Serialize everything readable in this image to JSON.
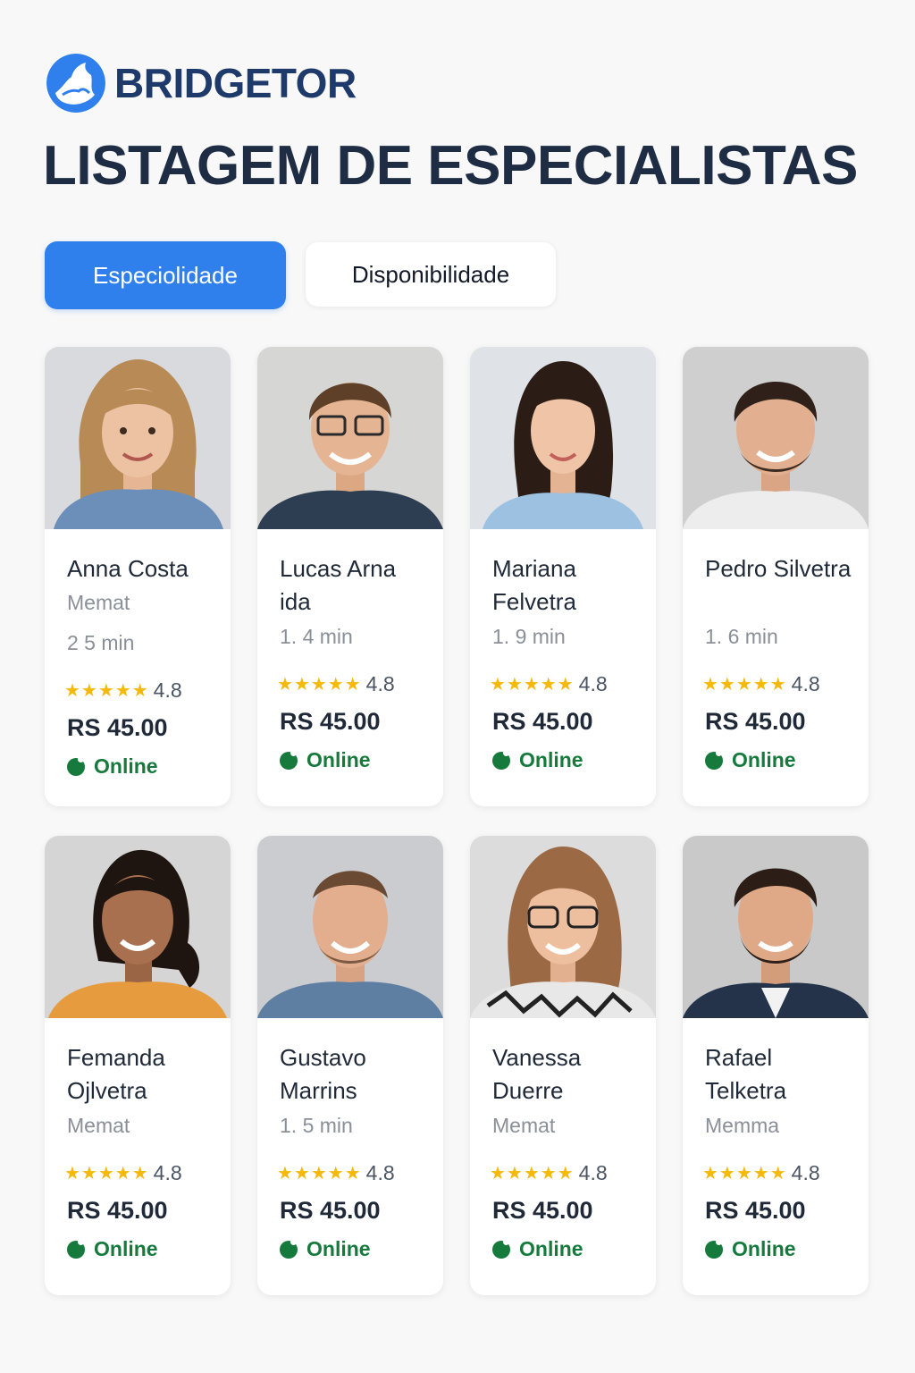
{
  "brand": {
    "name": "BRIDGETOR"
  },
  "page": {
    "title": "LISTAGEM DE ESPECIALISTAS"
  },
  "tabs": [
    {
      "label": "Especiolidade",
      "active": true
    },
    {
      "label": "Disponibilidade",
      "active": false
    }
  ],
  "specialists": [
    {
      "name": "Anna Costa",
      "meta": "Memat",
      "stars": "★★★★★",
      "rating": "4.8",
      "price": "RS 45.00",
      "status": "Online"
    },
    {
      "name": "Lucas Arna ida",
      "meta": "1. 4 min",
      "stars": "★★★★★",
      "rating": "4.8",
      "price": "RS 45.00",
      "status": "Online"
    },
    {
      "name": "Mariana Felvetra",
      "meta": "1. 9 min",
      "stars": "★★★★★",
      "rating": "4.8",
      "price": "RS 45.00",
      "status": "Online"
    },
    {
      "name": "Pedro Silvetra",
      "meta": "1. 6 min",
      "stars": "★★★★★",
      "rating": "4.8",
      "price": "RS 45.00",
      "status": "Online"
    },
    {
      "name": "Femanda Ojlvetra",
      "meta": "Memat",
      "stars": "★★★★★",
      "rating": "4.8",
      "price": "RS 45.00",
      "status": "Online"
    },
    {
      "name": "Gustavo Marrins",
      "meta": "1. 5 min",
      "stars": "★★★★★",
      "rating": "4.8",
      "price": "RS 45.00",
      "status": "Online"
    },
    {
      "name": "Vanessa Duerre",
      "meta": "Memat",
      "stars": "★★★★★",
      "rating": "4.8",
      "price": "RS 45.00",
      "status": "Online"
    },
    {
      "name": "Rafael Telketra",
      "meta": "Memma",
      "stars": "★★★★★",
      "rating": "4.8",
      "price": "RS 45.00",
      "status": "Online"
    }
  ],
  "first_card_extra_meta": "2  5 min",
  "colors": {
    "accent": "#2f80ed",
    "brand": "#1e3a6b",
    "online": "#157a3c",
    "star": "#f5b90a"
  }
}
